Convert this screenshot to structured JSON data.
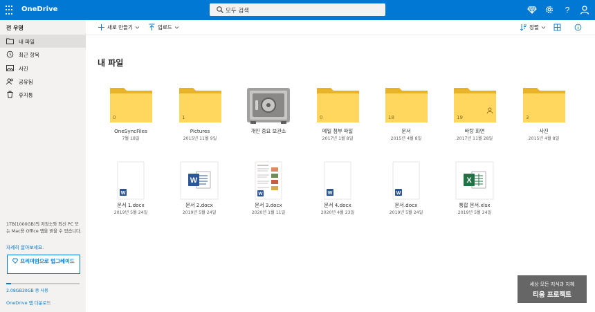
{
  "app": {
    "brand": "OneDrive"
  },
  "search": {
    "placeholder": "모두 검색"
  },
  "sidebar": {
    "user": "전 우영",
    "items": [
      {
        "label": "내 파일",
        "icon": "folder-icon",
        "active": true
      },
      {
        "label": "최근 항목",
        "icon": "history-icon"
      },
      {
        "label": "사진",
        "icon": "photo-icon"
      },
      {
        "label": "공유됨",
        "icon": "share-icon"
      },
      {
        "label": "휴지통",
        "icon": "trash-icon"
      }
    ],
    "storage_info": "1TB(1000GB)의 저장소와 최신 PC 또는 Mac용 Office 앱을 받을 수 있습니다.",
    "learn_more": "자세히 알아보세요.",
    "upgrade": "프리미엄으로 업그레이드",
    "quota": "2.08GB30GB 중 사용",
    "quota_fraction": 0.07,
    "download_link": "OneDrive 앱 다운로드"
  },
  "commands": {
    "new": "새로 만들기",
    "upload": "업로드",
    "sort": "정렬"
  },
  "main": {
    "title": "내 파일",
    "folders": [
      {
        "name": "OneSyncFiles",
        "date": "7월 18일",
        "count": "0",
        "type": "folder"
      },
      {
        "name": "Pictures",
        "date": "2015년 11월 9일",
        "count": "1",
        "type": "folder"
      },
      {
        "name": "개인 중요 보관소",
        "date": "",
        "count": "",
        "type": "vault"
      },
      {
        "name": "메일 첨부 파일",
        "date": "2017년 1월 8일",
        "count": "0",
        "type": "folder"
      },
      {
        "name": "문서",
        "date": "2015년 4월 8일",
        "count": "18",
        "type": "folder"
      },
      {
        "name": "바탕 화면",
        "date": "2017년 11월 28일",
        "count": "19",
        "type": "folder",
        "shared": true
      },
      {
        "name": "사진",
        "date": "2015년 4월 8일",
        "count": "3",
        "type": "folder"
      }
    ],
    "files": [
      {
        "name": "문서 1.docx",
        "date": "2019년 5월 24일",
        "type": "doc-small"
      },
      {
        "name": "문서 2.docx",
        "date": "2019년 5월 24일",
        "type": "word"
      },
      {
        "name": "문서 3.docx",
        "date": "2020년 1월 11일",
        "type": "doc-preview"
      },
      {
        "name": "문서 4.docx",
        "date": "2020년 4월 23일",
        "type": "doc-small"
      },
      {
        "name": "문서.docx",
        "date": "2019년 5월 24일",
        "type": "doc-small"
      },
      {
        "name": "통합 문서.xlsx",
        "date": "2019년 5월 24일",
        "type": "excel"
      }
    ]
  },
  "watermark": {
    "line1": "세상 모든 지식과 지혜",
    "line2": "티움 프로젝트"
  },
  "colors": {
    "accent": "#0078d4",
    "folder": "#ffd75e",
    "word": "#2b579a",
    "excel": "#217346"
  }
}
